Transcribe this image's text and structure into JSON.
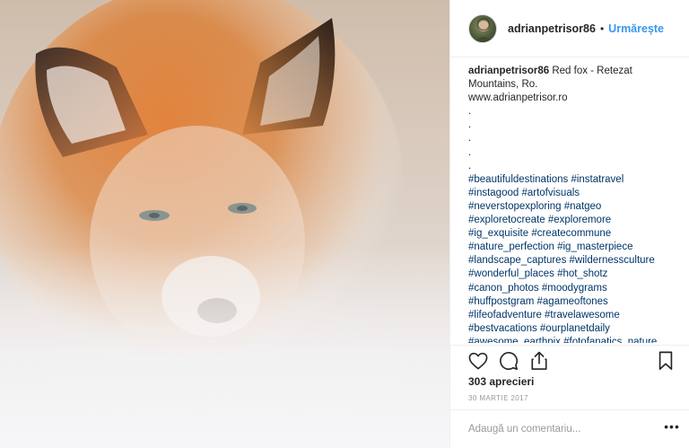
{
  "post": {
    "photo_alt": "Red fox - Retezat Mountains",
    "header": {
      "username": "adrianpetrisor86",
      "dot": "•",
      "follow_label": "Urmărește"
    },
    "caption": {
      "username": "adrianpetrisor86",
      "text_lines": [
        "Red fox - Retezat",
        "Mountains, Ro.",
        "www.adrianpetrisor.ro"
      ],
      "dots": [
        ".",
        ".",
        ".",
        ".",
        "."
      ],
      "hashtag_lines": [
        "#beautifuldestinations #instatravel",
        "#instagood #artofvisuals",
        "#neverstopexploring #natgeo",
        "#exploretocreate #exploremore",
        "#ig_exquisite #createcommune",
        "#nature_perfection #ig_masterpiece",
        "#landscape_captures #wildernessculture",
        "#wonderful_places #hot_shotz",
        "#canon_photos #moodygrams",
        "#huffpostgram #agameoftones",
        "#lifeofadventure #travelawesome",
        "#bestvacations #ourplanetdaily",
        "#awesome_earthpix #fotofanatics_nature"
      ]
    },
    "actions": {
      "like_icon": "heart-icon",
      "comment_icon": "comment-icon",
      "share_icon": "share-icon",
      "save_icon": "bookmark-icon"
    },
    "likes_text": "303 aprecieri",
    "date_text": "30 MARTIE 2017",
    "comment": {
      "placeholder": "Adaugă un comentariu...",
      "more_label": "•••"
    }
  }
}
